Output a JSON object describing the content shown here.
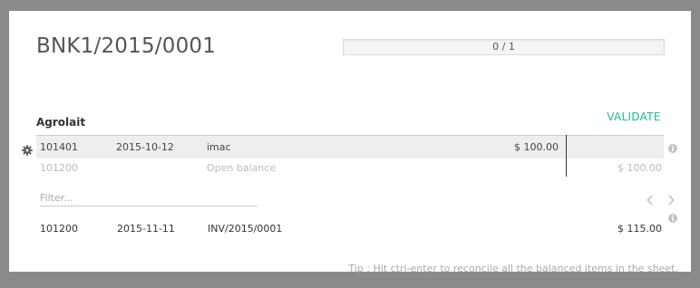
{
  "statement": {
    "name": "BNK1/2015/0001",
    "progress": {
      "text": "0 / 1",
      "fraction": 0
    }
  },
  "line": {
    "partner": "Agrolait",
    "validate_label": "VALIDATE",
    "matched": {
      "account": "101401",
      "date": "2015-10-12",
      "label": "imac",
      "debit": "$ 100.00",
      "credit": ""
    },
    "open_balance": {
      "account": "101200",
      "date": "",
      "label": "Open balance",
      "debit": "",
      "credit": "$ 100.00"
    }
  },
  "filter": {
    "placeholder": "Filter..."
  },
  "pager": {
    "prev_icon": "chevron-left-icon",
    "next_icon": "chevron-right-icon"
  },
  "proposals": [
    {
      "account": "101200",
      "date": "2015-11-11",
      "label": "INV/2015/0001",
      "amount": "$ 115.00"
    }
  ],
  "tip": "Tip : Hit ctrl-enter to reconcile all the balanced items in the sheet.",
  "colors": {
    "accent": "#21b799",
    "progress_fill": "#7c7bad",
    "overlay": "#8a8a8a"
  }
}
